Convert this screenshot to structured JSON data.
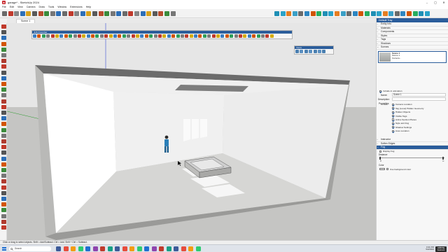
{
  "window": {
    "title": "garage* - SketchUp 2024",
    "controls": [
      "–",
      "▢",
      "✕"
    ]
  },
  "menu": [
    "File",
    "Edit",
    "View",
    "Camera",
    "Draw",
    "Tools",
    "Window",
    "Extensions",
    "Help"
  ],
  "tabs": [
    {
      "label": "Scene 1"
    }
  ],
  "floating_toolbars": [
    {
      "name": "3D Sketch toolbar",
      "title": "JHS Powerbar"
    },
    {
      "name": "Views toolbar",
      "title": "Views"
    }
  ],
  "tray": {
    "title": "Default Tray",
    "sections_top": [
      "Entity Info",
      "Materials",
      "Components",
      "Styles",
      "Tags",
      "Shadows",
      "Scenes"
    ],
    "scene": {
      "name": "Scene 1",
      "line2": "Scene 1",
      "line3": "Camera..."
    },
    "include_animation": "Include in animation",
    "name_label": "Name:",
    "name_value": "Scene 1",
    "description_label": "Description:",
    "properties_label": "Properties",
    "properties_sub": "to save:",
    "properties": [
      {
        "label": "Camera Location",
        "checked": true
      },
      {
        "label": "Tag (Level) Hidden Geometry",
        "checked": true
      },
      {
        "label": "Hidden Objects",
        "checked": true
      },
      {
        "label": "Visible Tags",
        "checked": true
      },
      {
        "label": "Active Section Planes",
        "checked": true
      },
      {
        "label": "Style and Fog",
        "checked": true
      },
      {
        "label": "Shadow Settings",
        "checked": true
      },
      {
        "label": "Axes Location",
        "checked": true
      }
    ],
    "sections_bottom": [
      "Instructor",
      "Soften Edges"
    ],
    "fog": {
      "title": "Fog",
      "display_fog": "Display Fog",
      "distance_label": "Distance",
      "distance_min": "0",
      "distance_max": "∞",
      "color_label": "Color",
      "use_bg": "Use background color"
    }
  },
  "status": "Click or drag to select objects. Shift = Add/Subtract. Ctrl = Add. Shift + Ctrl = Subtract.",
  "taskbar": {
    "search": "Search",
    "time": "3:41 PM",
    "date": "5/2/2024",
    "watermark_top": "udemy",
    "watermark_bottom": "business"
  },
  "colors": {
    "tray_header": "#2b5d9b",
    "sky": "#e6e6e6",
    "ground": "#c5c5c3",
    "wall": "#ffffff",
    "floor": "#d6d6d4"
  }
}
